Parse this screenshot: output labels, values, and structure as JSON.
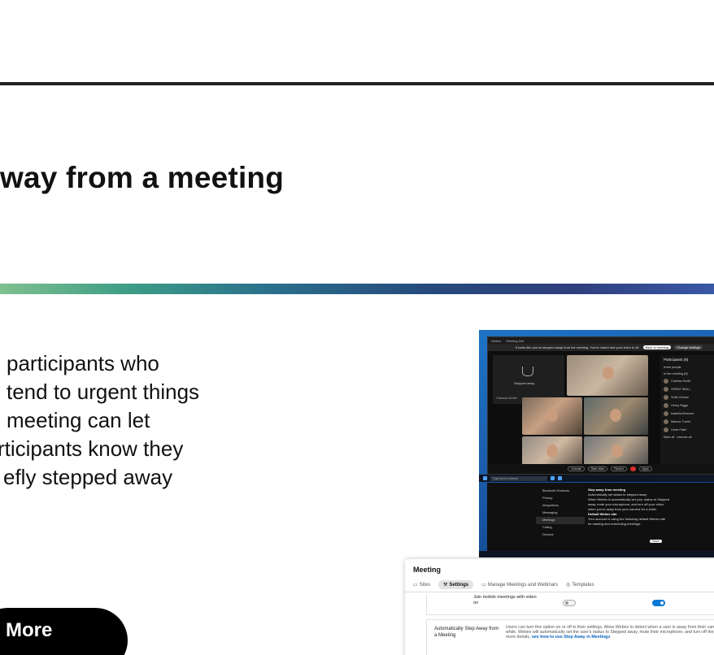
{
  "slide": {
    "headline": "way from a meeting",
    "body_lines": [
      "participants who",
      "tend to urgent things",
      "meeting can let",
      "rticipants know they",
      "efly stepped away"
    ],
    "more_button": "More"
  },
  "meeting_window": {
    "app_name": "Webex",
    "meeting_info": "Meeting info",
    "banner_text": "It looks like you've stepped away from the meeting. You're muted and your video is off.",
    "back_button": "Back to meeting",
    "change_settings_button": "Change settings",
    "stepped_away_label": "Stepped away",
    "stepped_away_name": "Clarissa Smith",
    "tile_caption": "Helen Metz",
    "participants_title": "Participants (8)",
    "participants": [
      "Invite people",
      "In the meeting (8)",
      "Clarissa Smith",
      "GREAT WALL",
      "Sofia Gomez",
      "Henry Riggs",
      "Isabella Brennan",
      "Marcus Turner",
      "Umar Patel"
    ],
    "participant_actions": [
      "Mute all",
      "Unmute all"
    ],
    "controls": [
      "Unmute",
      "Start video",
      "Record"
    ],
    "apps_label": "Apps"
  },
  "taskbar": {
    "search_placeholder": "Type here to search"
  },
  "settings_window": {
    "menu": [
      "Bluetooth Shortcuts",
      "Privacy",
      "Integrations",
      "Messaging",
      "Meetings",
      "Calling",
      "Devices"
    ],
    "selected_item": "Meetings",
    "heading": "Step away from meeting",
    "option": "Automatically set status to stepped away",
    "description": "When Webex is automatically set your status to Stepped away, mute your microphone, and turn off your video when you're away from your camera for a while.",
    "default_site_heading": "Default Webex site",
    "default_site_desc": "Your account is using the following default Webex site for starting and scheduling meetings.",
    "save_button": "Save",
    "cancel_button": "Cancel"
  },
  "control_hub": {
    "title": "Meeting",
    "tabs": [
      "Sites",
      "Settings",
      "Manage Meetings and Webinars",
      "Templates"
    ],
    "active_tab": "Settings",
    "row1_label": "Join mobile meetings with video on",
    "row2_label": "Automatically Step Away from a Meeting",
    "row2_description": "Users can turn this option on or off in their settings. Allow Webex to detect when a user is away from their camera for a while. Webex will automatically set the user's status to Stepped away, mute their microphone, and turn off their video. For more details,",
    "row2_link": "see how to use Step Away in Meetings"
  },
  "colors": {
    "top_rule": "#222222",
    "more_button_bg": "#000000",
    "hub_toggle_on": "#0a78d5"
  }
}
